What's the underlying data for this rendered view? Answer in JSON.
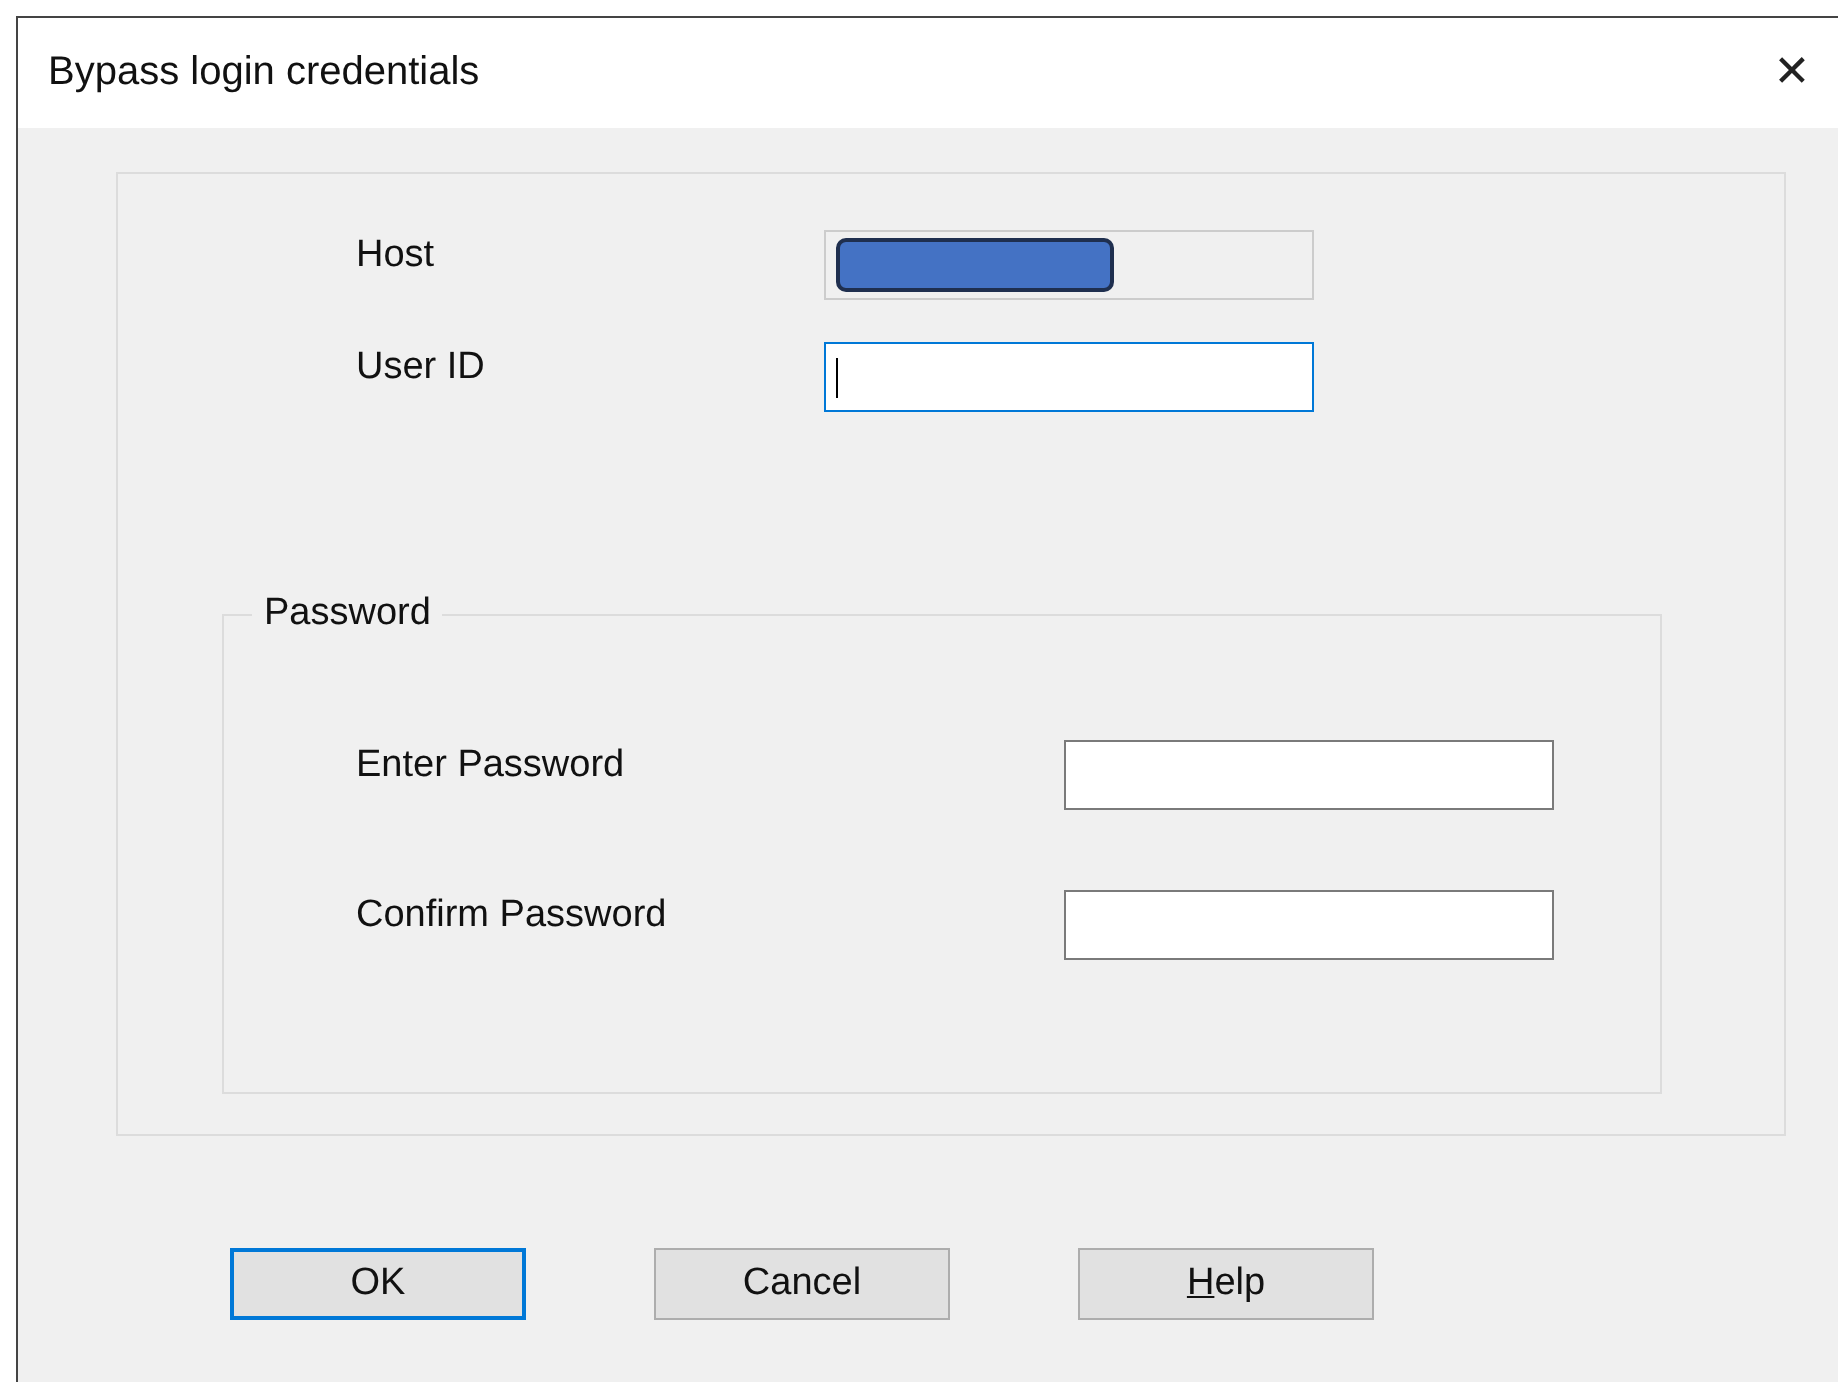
{
  "window": {
    "title": "Bypass login credentials",
    "close": "✕"
  },
  "fields": [
    {
      "label": "Host",
      "readonly": true,
      "focused": false
    },
    {
      "label": "User ID",
      "readonly": false,
      "focused": true
    }
  ],
  "password_group": {
    "title": "Password",
    "fields": [
      {
        "label": "Enter Password",
        "focused": false
      },
      {
        "label": "Confirm Password",
        "focused": false
      }
    ]
  },
  "buttons": [
    {
      "label": "OK",
      "default": true
    },
    {
      "label": "Cancel",
      "default": false
    },
    {
      "mnemonic": "H",
      "label": "elp",
      "default": false
    }
  ]
}
